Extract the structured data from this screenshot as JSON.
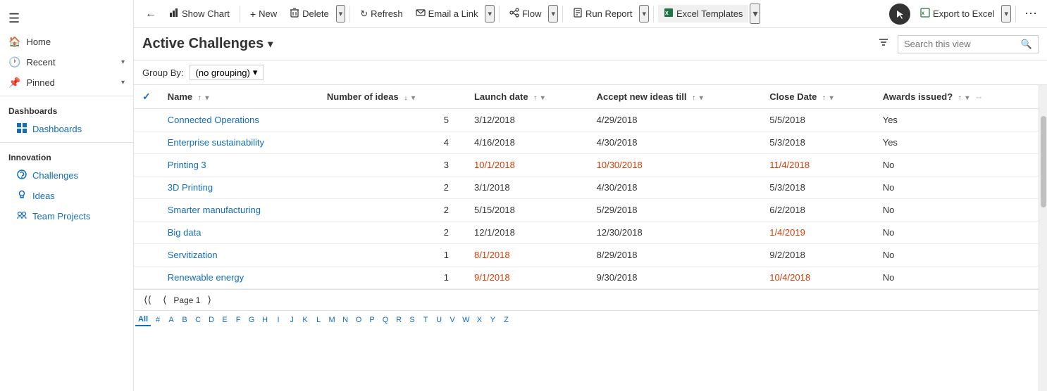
{
  "sidebar": {
    "hamburger": "☰",
    "sections": [
      {
        "label": "Home",
        "icon": "🏠",
        "type": "item-top"
      },
      {
        "label": "Recent",
        "icon": "🕐",
        "type": "item-top",
        "hasChevron": true
      },
      {
        "label": "Pinned",
        "icon": "📌",
        "type": "item-top",
        "hasChevron": true
      }
    ],
    "groups": [
      {
        "label": "Dashboards",
        "items": [
          {
            "label": "Dashboards",
            "icon": "grid"
          }
        ]
      },
      {
        "label": "Innovation",
        "items": [
          {
            "label": "Challenges",
            "icon": "puzzle"
          },
          {
            "label": "Ideas",
            "icon": "lightbulb"
          },
          {
            "label": "Team Projects",
            "icon": "people"
          }
        ]
      }
    ]
  },
  "toolbar": {
    "back_icon": "←",
    "show_chart_label": "Show Chart",
    "new_label": "New",
    "delete_label": "Delete",
    "refresh_label": "Refresh",
    "email_link_label": "Email a Link",
    "flow_label": "Flow",
    "run_report_label": "Run Report",
    "excel_templates_label": "Excel Templates",
    "export_to_excel_label": "Export to Excel",
    "more_icon": "⋯"
  },
  "header": {
    "title": "Active Challenges",
    "filter_icon": "filter",
    "search_placeholder": "Search this view",
    "search_icon": "🔍"
  },
  "groupby": {
    "label": "Group By:",
    "value": "(no grouping)"
  },
  "table": {
    "columns": [
      {
        "key": "check",
        "label": ""
      },
      {
        "key": "name",
        "label": "Name",
        "sort": "asc"
      },
      {
        "key": "ideas",
        "label": "Number of ideas",
        "sort": "desc"
      },
      {
        "key": "launch",
        "label": "Launch date",
        "sort": "asc"
      },
      {
        "key": "accept",
        "label": "Accept new ideas till",
        "sort": "asc"
      },
      {
        "key": "close",
        "label": "Close Date",
        "sort": "asc"
      },
      {
        "key": "awards",
        "label": "Awards issued?",
        "sort": "asc"
      }
    ],
    "rows": [
      {
        "name": "Connected Operations",
        "ideas": 5,
        "launch": "3/12/2018",
        "accept": "4/29/2018",
        "close": "5/5/2018",
        "close_overdue": false,
        "awards": "Yes",
        "launch_overdue": false,
        "accept_overdue": false
      },
      {
        "name": "Enterprise sustainability",
        "ideas": 4,
        "launch": "4/16/2018",
        "accept": "4/30/2018",
        "close": "5/3/2018",
        "close_overdue": false,
        "awards": "Yes",
        "launch_overdue": false,
        "accept_overdue": false
      },
      {
        "name": "Printing 3",
        "ideas": 3,
        "launch": "10/1/2018",
        "accept": "10/30/2018",
        "close": "11/4/2018",
        "close_overdue": true,
        "awards": "No",
        "launch_overdue": true,
        "accept_overdue": true
      },
      {
        "name": "3D Printing",
        "ideas": 2,
        "launch": "3/1/2018",
        "accept": "4/30/2018",
        "close": "5/3/2018",
        "close_overdue": false,
        "awards": "No",
        "launch_overdue": false,
        "accept_overdue": false
      },
      {
        "name": "Smarter manufacturing",
        "ideas": 2,
        "launch": "5/15/2018",
        "accept": "5/29/2018",
        "close": "6/2/2018",
        "close_overdue": false,
        "awards": "No",
        "launch_overdue": false,
        "accept_overdue": false
      },
      {
        "name": "Big data",
        "ideas": 2,
        "launch": "12/1/2018",
        "accept": "12/30/2018",
        "close": "1/4/2019",
        "close_overdue": true,
        "awards": "No",
        "launch_overdue": false,
        "accept_overdue": false
      },
      {
        "name": "Servitization",
        "ideas": 1,
        "launch": "8/1/2018",
        "accept": "8/29/2018",
        "close": "9/2/2018",
        "close_overdue": false,
        "awards": "No",
        "launch_overdue": true,
        "accept_overdue": false
      },
      {
        "name": "Renewable energy",
        "ideas": 1,
        "launch": "9/1/2018",
        "accept": "9/30/2018",
        "close": "10/4/2018",
        "close_overdue": true,
        "awards": "No",
        "launch_overdue": true,
        "accept_overdue": false
      }
    ]
  },
  "pagination": {
    "page_label": "Page 1",
    "first_icon": "⟨⟨",
    "prev_icon": "⟨",
    "next_icon": "⟩"
  },
  "alpha_bar": {
    "items": [
      "All",
      "#",
      "A",
      "B",
      "C",
      "D",
      "E",
      "F",
      "G",
      "H",
      "I",
      "J",
      "K",
      "L",
      "M",
      "N",
      "O",
      "P",
      "Q",
      "R",
      "S",
      "T",
      "U",
      "V",
      "W",
      "X",
      "Y",
      "Z"
    ],
    "active": "All"
  },
  "colors": {
    "link": "#106ebe",
    "overdue": "#d83b01",
    "normal_date": "#333"
  }
}
